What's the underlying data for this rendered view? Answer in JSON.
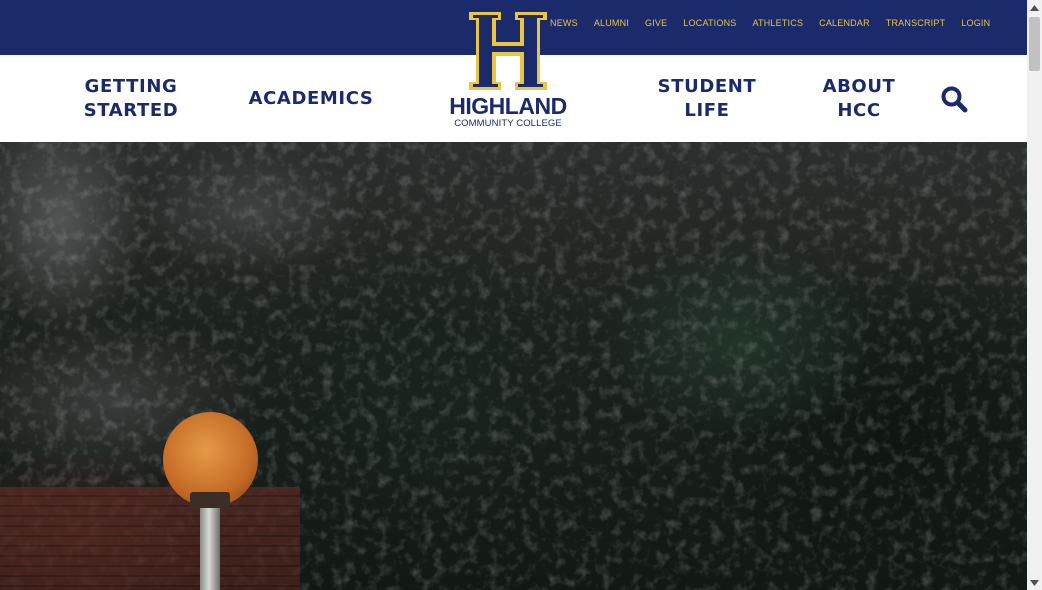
{
  "utility_nav": {
    "links": [
      "NEWS",
      "ALUMNI",
      "GIVE",
      "LOCATIONS",
      "ATHLETICS",
      "CALENDAR",
      "TRANSCRIPT",
      "LOGIN"
    ]
  },
  "main_nav": {
    "getting_started": [
      "GETTING",
      "STARTED"
    ],
    "academics": "ACADEMICS",
    "student_life": [
      "STUDENT",
      "LIFE"
    ],
    "about": [
      "ABOUT",
      "HCC"
    ]
  },
  "logo": {
    "letter": "H",
    "name": "HIGHLAND",
    "subtitle": "COMMUNITY COLLEGE"
  },
  "icons": {
    "search": "search-icon",
    "scroll_up": "scroll-up-arrow-icon",
    "scroll_down": "scroll-down-arrow-icon"
  },
  "colors": {
    "navy": "#1a2a6b",
    "gold": "#e8c547"
  }
}
